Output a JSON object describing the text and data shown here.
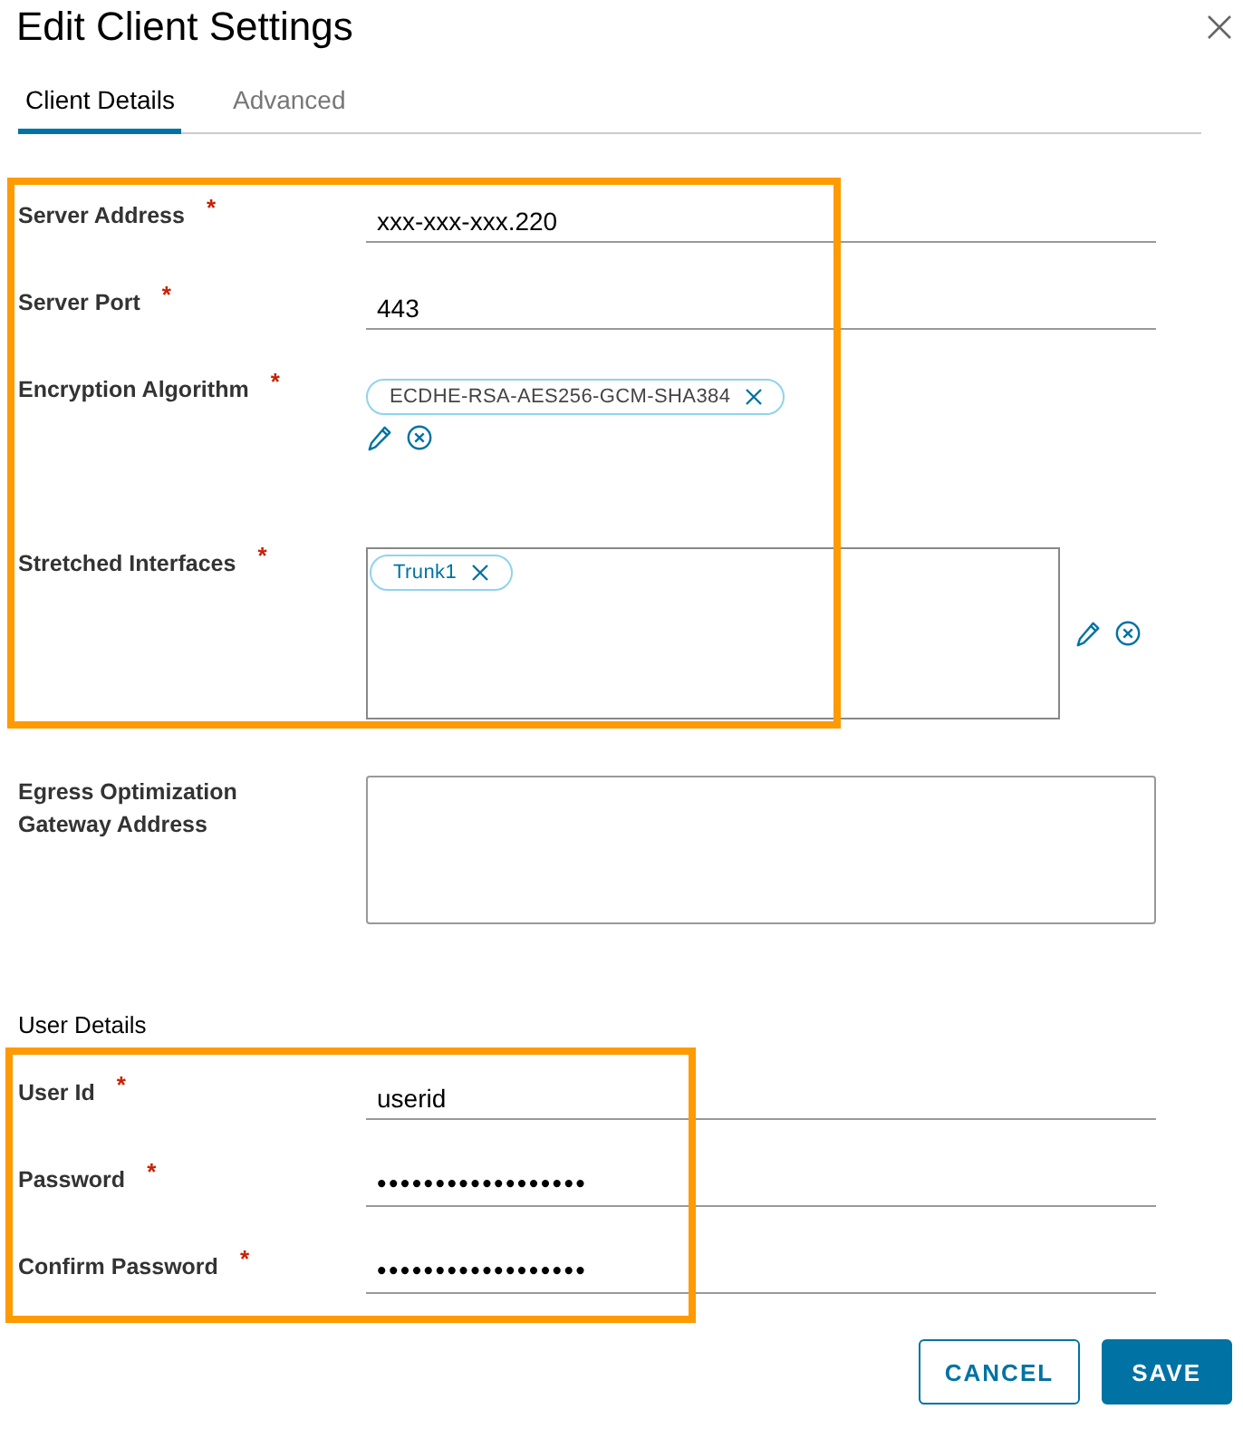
{
  "window": {
    "title": "Edit Client Settings"
  },
  "required_marker": "*",
  "tabs": [
    {
      "label": "Client Details",
      "selected": true
    },
    {
      "label": "Advanced",
      "selected": false
    }
  ],
  "sections": [
    {
      "highlighted": true,
      "fields": [
        {
          "kind": "text",
          "label": "Server Address",
          "required": true,
          "value": "xxx-xxx-xxx.220"
        },
        {
          "kind": "text",
          "label": "Server Port",
          "required": true,
          "value": "443"
        },
        {
          "kind": "chips",
          "label": "Encryption Algorithm",
          "required": true,
          "chips": [
            "ECDHE-RSA-AES256-GCM-SHA384"
          ]
        },
        {
          "kind": "chipbox",
          "label": "Stretched Interfaces",
          "required": true,
          "chips": [
            "Trunk1"
          ]
        }
      ]
    },
    {
      "highlighted": false,
      "fields": [
        {
          "kind": "textarea",
          "label": "Egress Optimization Gateway Address",
          "required": false
        }
      ]
    },
    {
      "heading": "User Details",
      "highlighted": true,
      "fields": [
        {
          "kind": "text",
          "label": "User Id",
          "required": true,
          "value": "userid"
        },
        {
          "kind": "password",
          "label": "Password",
          "required": true,
          "value": "••••••••••••••••••"
        },
        {
          "kind": "password",
          "label": "Confirm Password",
          "required": true,
          "value": "••••••••••••••••••"
        }
      ]
    }
  ],
  "buttons": [
    {
      "label": "CANCEL",
      "kind": "secondary"
    },
    {
      "label": "SAVE",
      "kind": "primary"
    }
  ]
}
